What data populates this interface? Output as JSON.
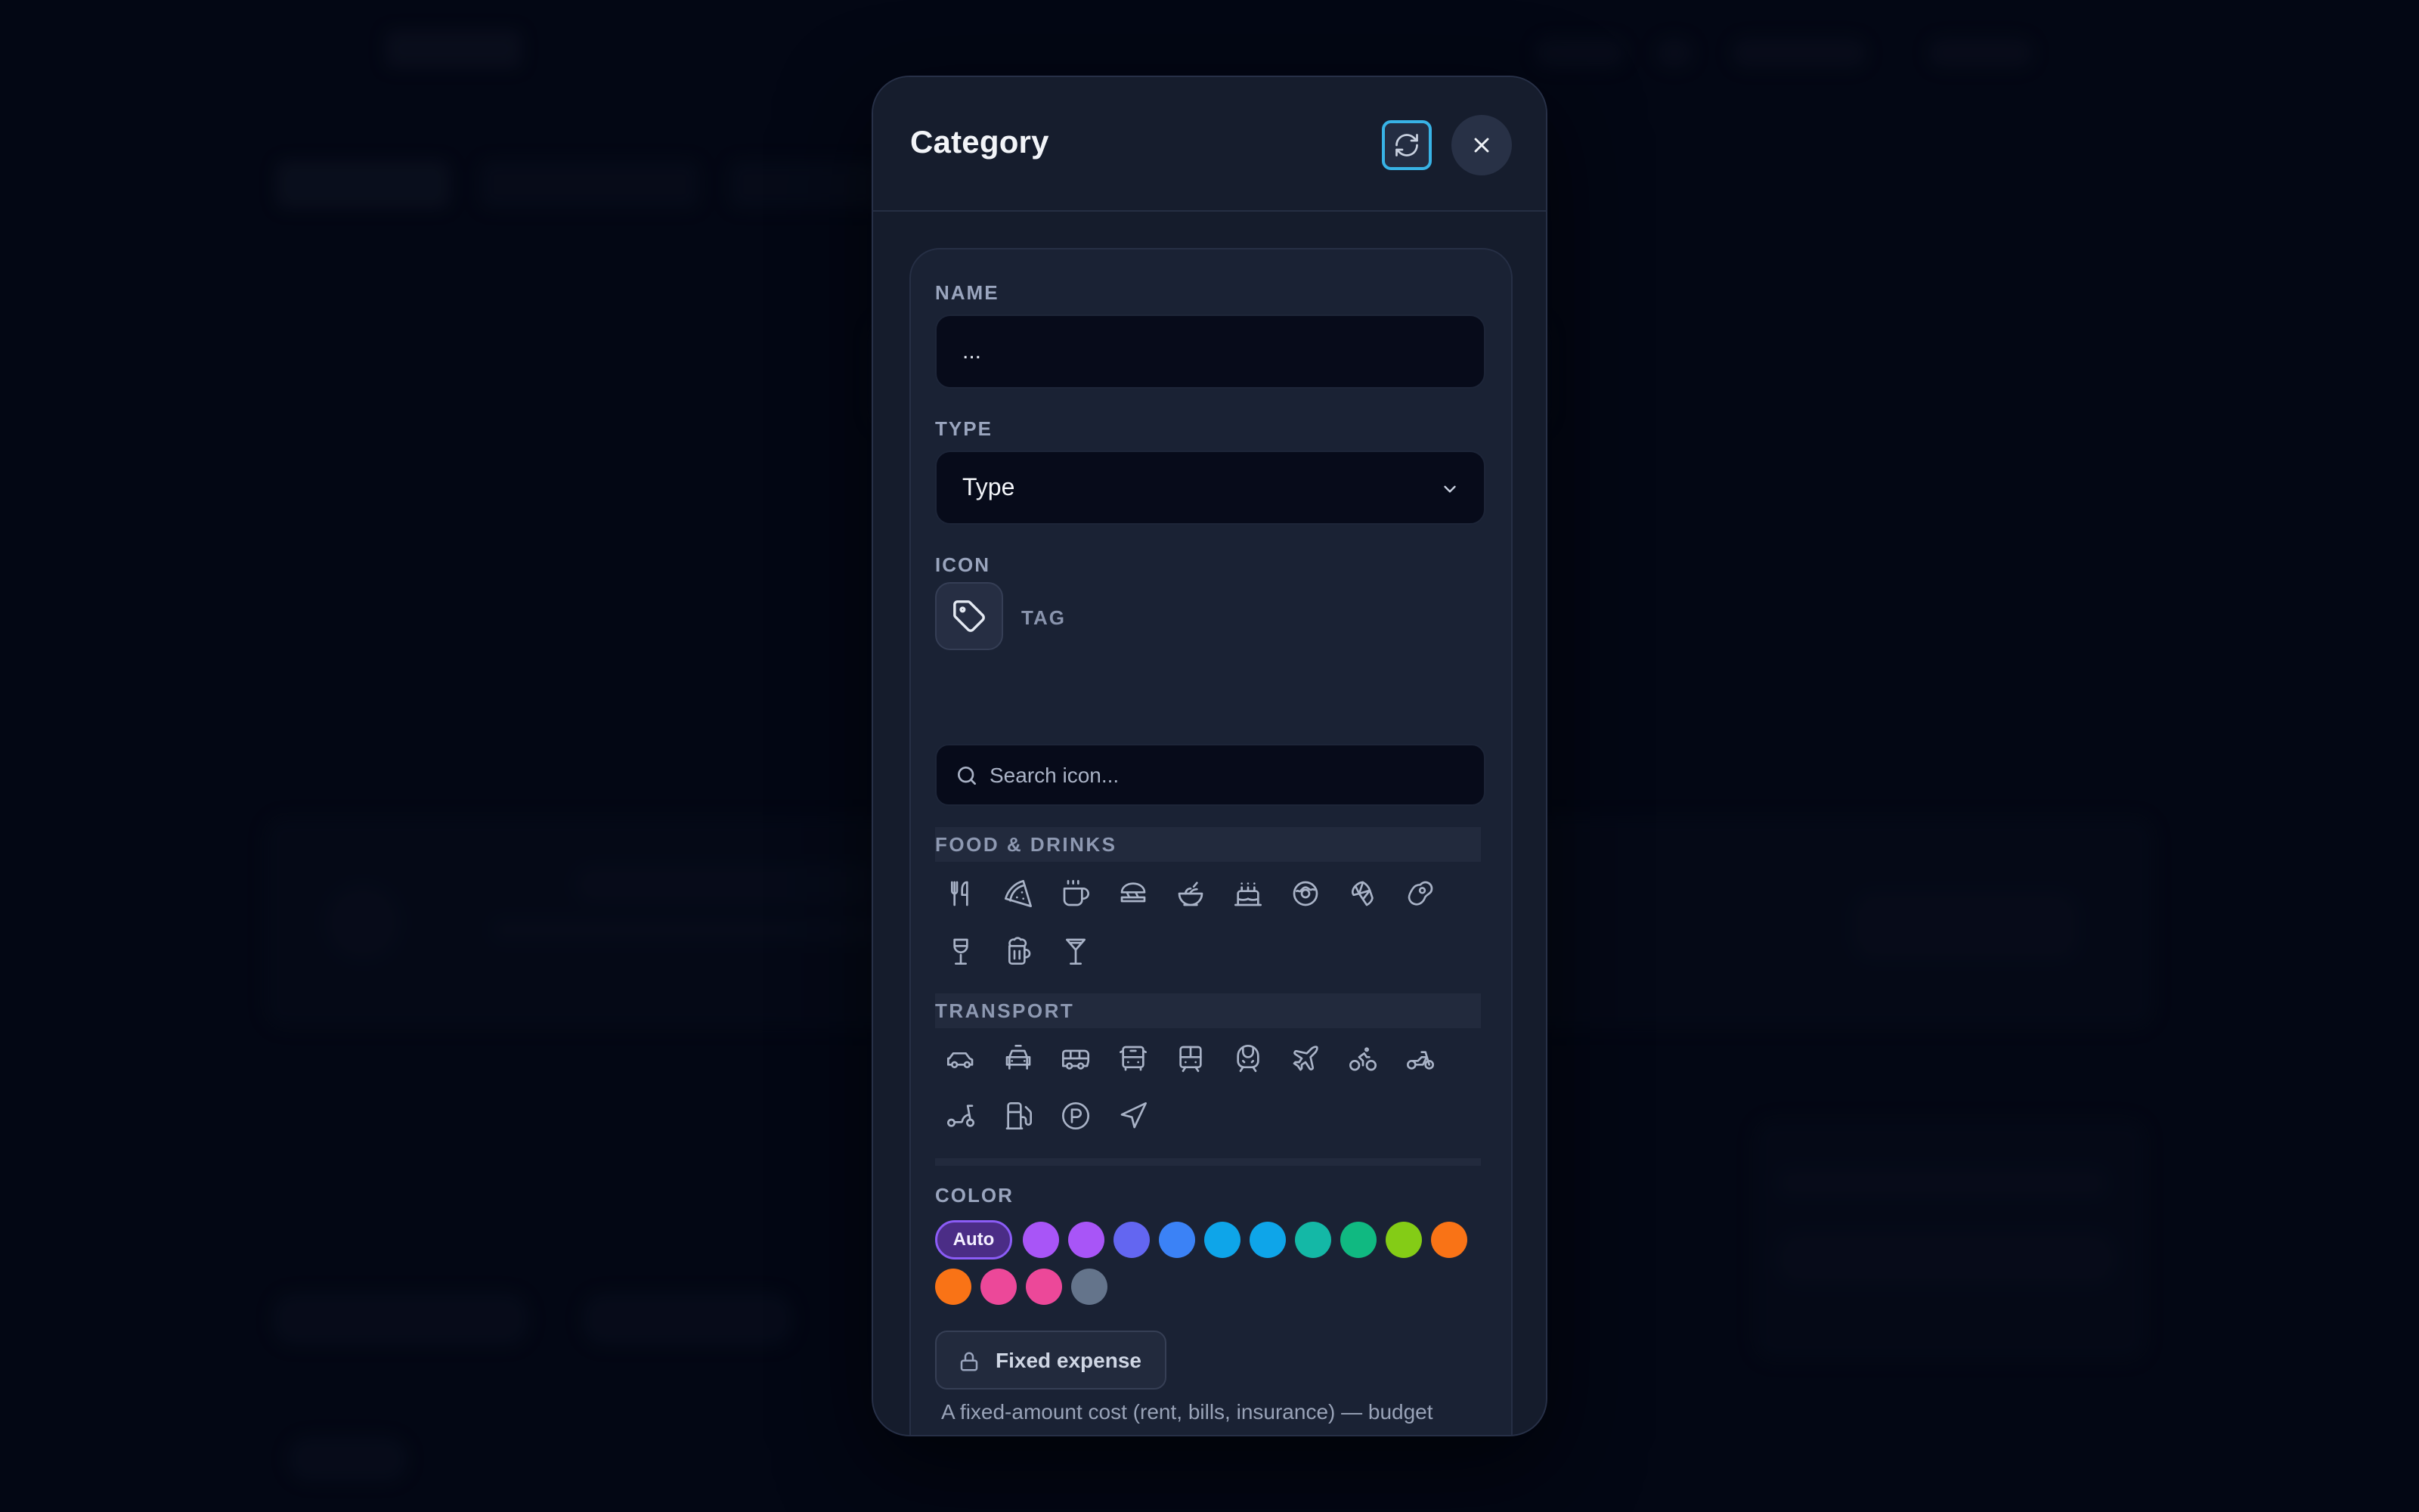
{
  "modal": {
    "title": "Category",
    "name": {
      "label": "NAME",
      "value": "..."
    },
    "type": {
      "label": "TYPE",
      "value": "Type"
    },
    "icon": {
      "label": "ICON",
      "selected": "TAG",
      "search_placeholder": "Search icon..."
    },
    "sections": [
      {
        "title": "FOOD & DRINKS",
        "icons": [
          "utensils-icon",
          "pizza-icon",
          "coffee-icon",
          "sandwich-icon",
          "salad-icon",
          "cake-icon",
          "donut-icon",
          "croissant-icon",
          "steak-icon",
          "wine-icon",
          "beer-icon",
          "cocktail-icon"
        ]
      },
      {
        "title": "TRANSPORT",
        "icons": [
          "car-icon",
          "taxi-icon",
          "bus-icon",
          "bus-front-icon",
          "tram-icon",
          "train-icon",
          "plane-icon",
          "bicycle-icon",
          "motorcycle-icon",
          "scooter-icon",
          "fuel-icon",
          "parking-icon",
          "navigation-icon"
        ]
      }
    ],
    "color": {
      "label": "COLOR",
      "auto_label": "Auto",
      "swatches": [
        "#a855f7",
        "#a855f7",
        "#6366f1",
        "#3b82f6",
        "#0ea5e9",
        "#0ea5e9",
        "#14b8a6",
        "#10b981",
        "#84cc16",
        "#f97316",
        "#f97316",
        "#ec4899",
        "#ec4899",
        "#64748b"
      ]
    },
    "fixed_expense": {
      "label": "Fixed expense",
      "description": "A fixed-amount cost (rent, bills, insurance) — budget recommendations will never suggest trimming it"
    },
    "accent": "#38b3e6"
  }
}
